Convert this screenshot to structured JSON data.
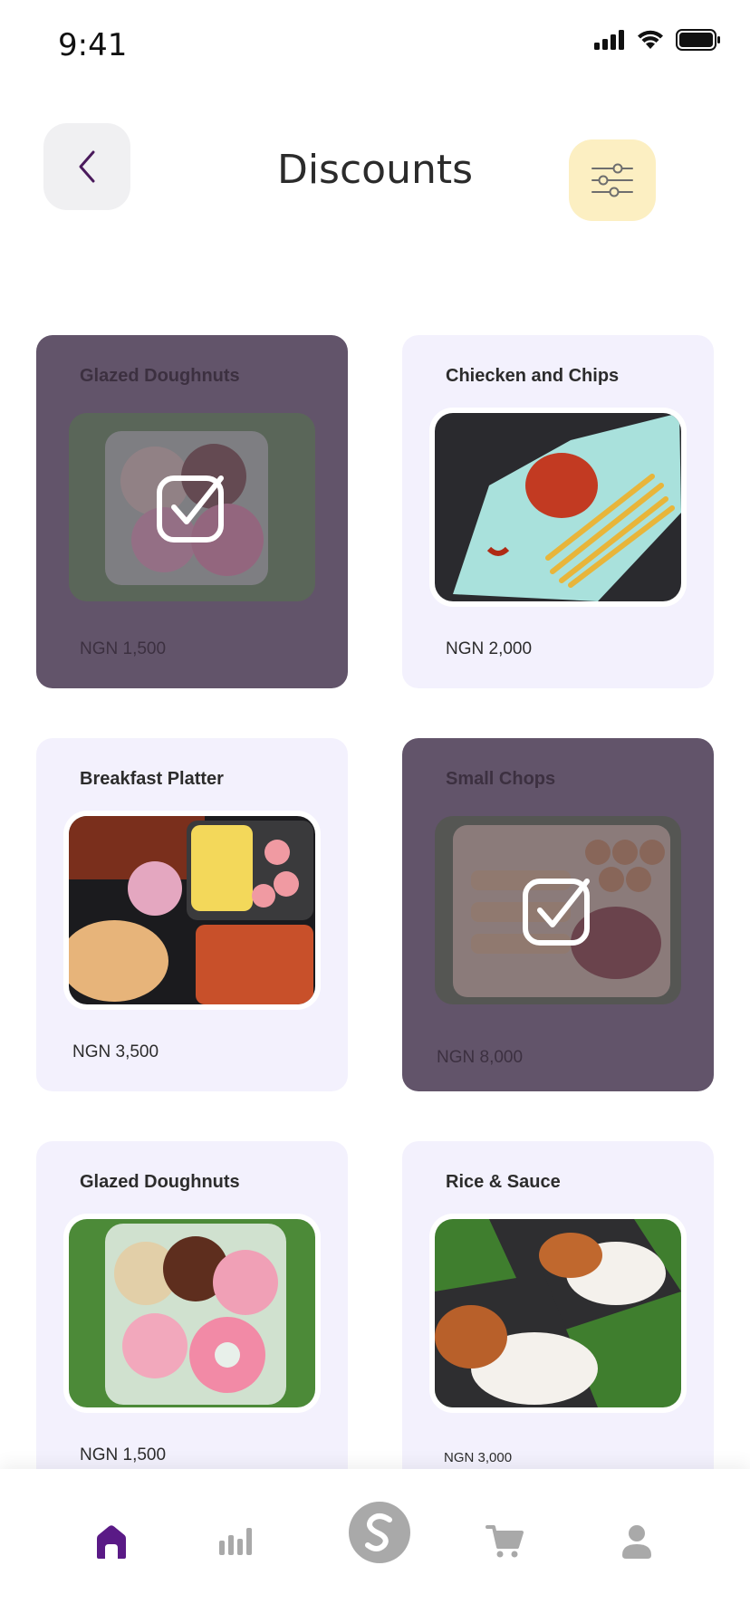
{
  "status_bar": {
    "time": "9:41",
    "icons": [
      "signal-icon",
      "wifi-icon",
      "battery-icon"
    ]
  },
  "header": {
    "title": "Discounts",
    "back_icon": "chevron-left-icon",
    "filter_icon": "sliders-icon"
  },
  "colors": {
    "card_bg": "#f3f1fd",
    "selected_overlay": "#62546a",
    "filter_bg": "#fcefc2",
    "accent": "#5a1a86"
  },
  "items": [
    {
      "name": "Glazed Doughnuts",
      "price": "NGN 1,500",
      "selected": true,
      "image": "doughnuts"
    },
    {
      "name": "Chiecken and Chips",
      "price": "NGN 2,000",
      "selected": false,
      "image": "chicken"
    },
    {
      "name": "Breakfast Platter",
      "price": "NGN 3,500",
      "selected": false,
      "image": "breakfast"
    },
    {
      "name": "Small Chops",
      "price": "NGN 8,000",
      "selected": true,
      "image": "smallchops"
    },
    {
      "name": "Glazed Doughnuts",
      "price": "NGN 1,500",
      "selected": false,
      "image": "doughnuts"
    },
    {
      "name": "Rice & Sauce",
      "price": "NGN 3,000",
      "selected": false,
      "image": "rice"
    }
  ],
  "bottom_nav": [
    {
      "icon": "home-icon",
      "active": true
    },
    {
      "icon": "stats-icon",
      "active": false
    },
    {
      "icon": "brand-s-icon",
      "active": false
    },
    {
      "icon": "cart-icon",
      "active": false
    },
    {
      "icon": "profile-icon",
      "active": false
    }
  ]
}
